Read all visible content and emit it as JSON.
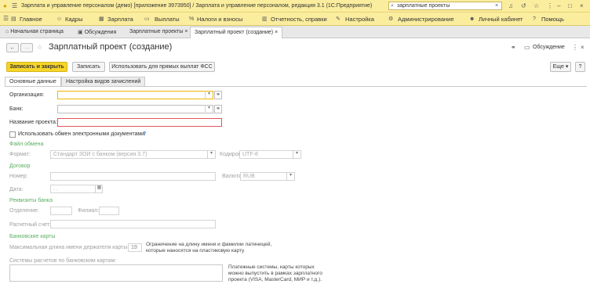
{
  "titlebar": {
    "title": "Зарплата и управление персоналом (демо) [приложение 3973950] / Зарплата и управление персоналом, редакция 3.1 (1С:Предприятие)",
    "search_value": "зарплатные проекты"
  },
  "menu": {
    "items": [
      {
        "label": "Главное"
      },
      {
        "label": "Кадры"
      },
      {
        "label": "Зарплата"
      },
      {
        "label": "Выплаты"
      },
      {
        "label": "Налоги и взносы"
      },
      {
        "label": "Отчетность, справки"
      },
      {
        "label": "Настройка"
      },
      {
        "label": "Администрирование"
      },
      {
        "label": "Личный кабинет"
      },
      {
        "label": "Помощь"
      }
    ]
  },
  "tabs": [
    {
      "label": "Начальная страница"
    },
    {
      "label": "Обсуждения"
    },
    {
      "label": "Зарплатные проекты"
    },
    {
      "label": "Зарплатный проект (создание)"
    }
  ],
  "form": {
    "title": "Зарплатный проект (создание)",
    "discussions": "Обсуждение",
    "buttons": {
      "save_close": "Записать и закрыть",
      "save": "Записать",
      "use_fss": "Использовать для прямых выплат ФСС",
      "more": "Еще",
      "help": "?"
    },
    "subtabs": [
      "Основные данные",
      "Настройка видов зачислений"
    ],
    "org_label": "Организация:",
    "bank_label": "Банк:",
    "name_label": "Название проекта:",
    "edoc_label": "Использовать обмен электронными документами",
    "exchange_group": "Файл обмена",
    "format_label": "Формат:",
    "format_value": "Стандарт ЗОИ с банком (версия 3.7)",
    "encoding_label": "Кодировка:",
    "encoding_value": "UTF-8",
    "contract_group": "Договор",
    "number_label": "Номер:",
    "currency_label": "Валюта:",
    "currency_value": "RUB",
    "date_label": "Дата:",
    "date_value": ". .",
    "bank_details_group": "Реквизиты банка",
    "branch_label": "Отделение:",
    "filial_label": "Филиал:",
    "account_label": "Расчетный счет:",
    "cards_group": "Банковские карты",
    "max_len_label": "Максимальная длина имени держателя карты:",
    "max_len_value": "19",
    "max_len_note": "Ограничение на длину имени и фамилии латиницей, которые наносятся на пластиковую карту",
    "systems_label": "Системы расчетов по банковским картам:",
    "systems_note": "Платежные системы, карты которых можно выпустить в рамках зарплатного проекта (VISA, MasterCard, МИР и т.д.)."
  },
  "colors": {
    "accent": "#fbed9e",
    "primary_button": "#f6d52a",
    "group_title": "#5cae62",
    "required_border": "#e0565a"
  }
}
